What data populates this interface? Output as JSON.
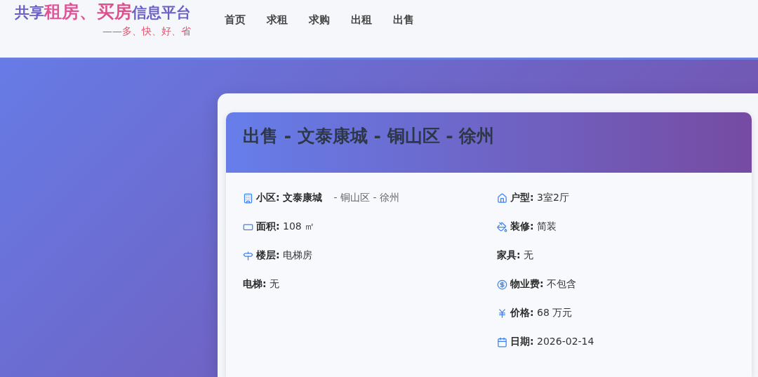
{
  "logo": {
    "parts": [
      {
        "text": "共享",
        "kind": "plain"
      },
      {
        "text": "租房、买房",
        "kind": "highlight"
      },
      {
        "text": "信息平台",
        "kind": "plain"
      }
    ],
    "slogan": "——多、快、好、省"
  },
  "nav": [
    {
      "label": "首页"
    },
    {
      "label": "求租"
    },
    {
      "label": "求购"
    },
    {
      "label": "出租"
    },
    {
      "label": "出售"
    }
  ],
  "listing": {
    "title": "出售 - 文泰康城 - 铜山区 - 徐州",
    "columns": [
      [
        {
          "kind": "building",
          "text": "**小区: 文泰康城**",
          "extra": "- 铜山区 - 徐州"
        },
        {
          "kind": "area",
          "text": "**面积:** 108 ㎡"
        },
        {
          "kind": "signpost",
          "text": "**楼层:** 电梯房"
        },
        {
          "kind": "plain",
          "text": "**电梯:** 无"
        }
      ],
      [
        {
          "kind": "house",
          "text": "**户型:** 3室2厅"
        },
        {
          "kind": "paint",
          "text": "**装修:** 简装"
        },
        {
          "kind": "plain",
          "text": "**家具:** 无"
        },
        {
          "kind": "dollar",
          "text": "**物业费:** 不包含"
        },
        {
          "kind": "yen",
          "text": "**价格:** 68 万元"
        },
        {
          "kind": "calendar",
          "text": "**日期:** 2026-02-14"
        }
      ]
    ]
  }
}
